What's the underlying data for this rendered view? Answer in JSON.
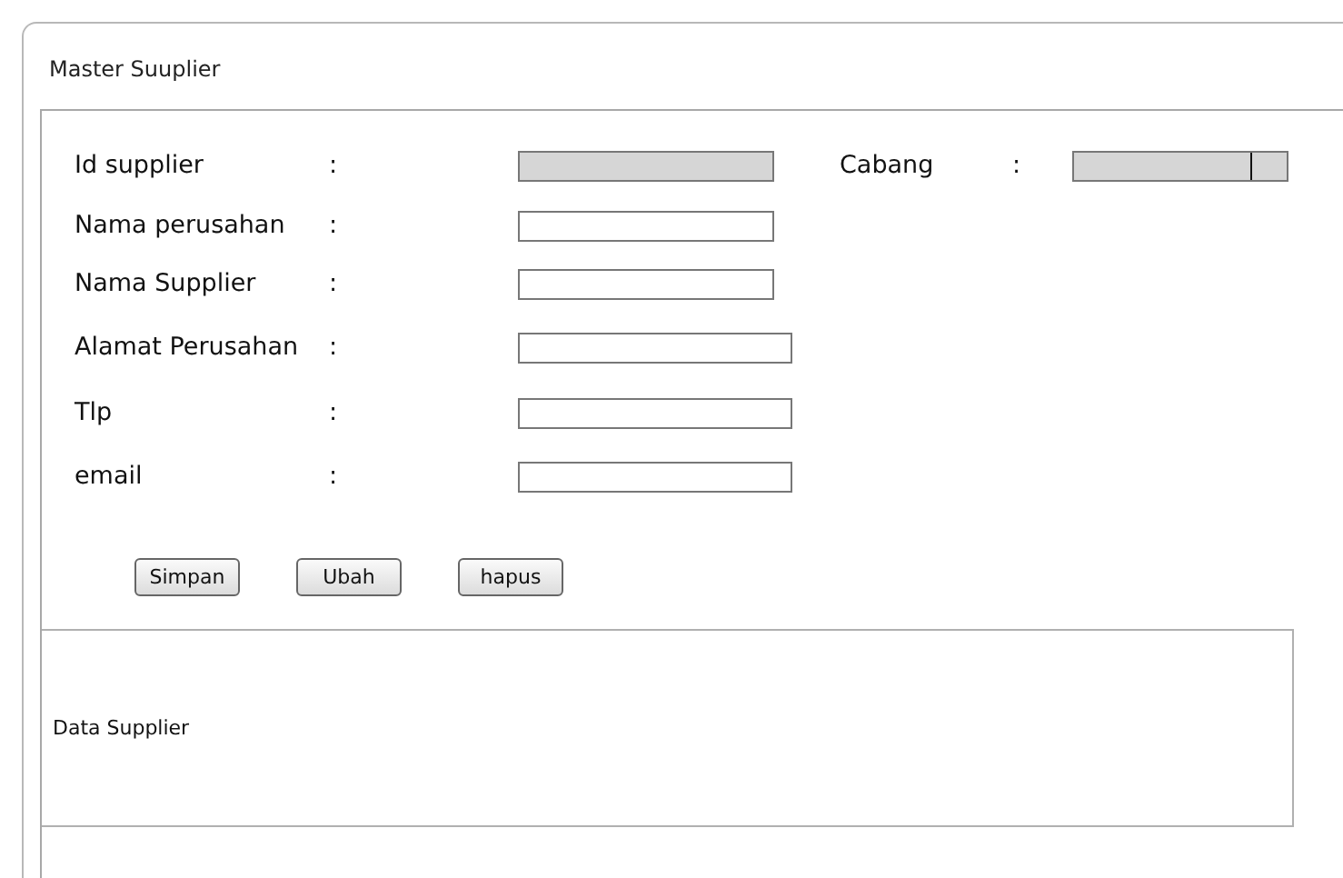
{
  "window": {
    "title": "Master Suuplier"
  },
  "fields": [
    {
      "label": "Id  supplier",
      "separator": ":",
      "kind": "text",
      "disabled": true
    },
    {
      "label": "Nama perusahan",
      "separator": ":",
      "kind": "text",
      "disabled": false
    },
    {
      "label": "Nama Supplier",
      "separator": ":",
      "kind": "text",
      "disabled": false
    },
    {
      "label": "Alamat  Perusahan",
      "separator": ":",
      "kind": "text",
      "disabled": false
    },
    {
      "label": "Tlp",
      "separator": ":",
      "kind": "text",
      "disabled": false
    },
    {
      "label": "email",
      "separator": ":",
      "kind": "text",
      "disabled": false
    }
  ],
  "cabang": {
    "label": "Cabang",
    "separator": ":",
    "kind": "select",
    "disabled": true
  },
  "buttons": [
    "Simpan",
    "Ubah",
    "hapus"
  ],
  "data_grid": {
    "label": "Data Supplier"
  }
}
